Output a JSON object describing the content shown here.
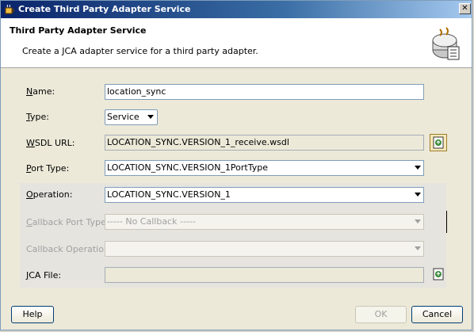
{
  "window": {
    "title": "Create Third Party Adapter Service",
    "close_glyph": "✕"
  },
  "header": {
    "title": "Third Party Adapter Service",
    "subtitle": "Create a JCA adapter service for a third party adapter."
  },
  "form": {
    "name": {
      "label": "Name:",
      "mnemonic": "N",
      "rest": "ame:",
      "value": "location_sync"
    },
    "type": {
      "label": "Type:",
      "mnemonic": "T",
      "rest": "ype:",
      "value": "Service"
    },
    "wsdl_url": {
      "label": "WSDL URL:",
      "mnemonic": "W",
      "rest": "SDL URL:",
      "value": "LOCATION_SYNC.VERSION_1_receive.wsdl"
    },
    "port_type": {
      "label": "Port Type:",
      "mnemonic": "P",
      "rest": "ort Type:",
      "value": "LOCATION_SYNC.VERSION_1PortType"
    },
    "operation": {
      "label": "Operation:",
      "mnemonic": "O",
      "rest": "peration:",
      "value": "LOCATION_SYNC.VERSION_1"
    },
    "callback_port_type": {
      "label": "Callback Port Type:",
      "mnemonic": "C",
      "rest": "allback Port Type:",
      "value": "----- No Callback -----"
    },
    "callback_operation": {
      "label": "Callback Operation:",
      "mnemonic": "",
      "rest": "Callback Operation:",
      "value": ""
    },
    "jca_file": {
      "label": "JCA File:",
      "mnemonic": "J",
      "rest": "CA File:",
      "value": ""
    }
  },
  "buttons": {
    "help": "Help",
    "ok": "OK",
    "cancel": "Cancel"
  },
  "icons": {
    "app": "oracle-cup-icon",
    "header": "adapter-service-icon",
    "wsdl_browse": "browse-wsdl-icon",
    "jca_browse": "browse-jca-icon"
  }
}
